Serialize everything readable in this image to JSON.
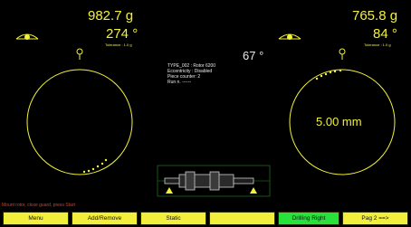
{
  "left": {
    "weight": "982.7 g",
    "angle": "274 °",
    "tolerance": "Tolerance : 1.0 g"
  },
  "right": {
    "weight": "765.8 g",
    "angle": "84 °",
    "tolerance": "Tolerance : 1.0 g",
    "distance": "5.00 mm"
  },
  "center": {
    "angle": "67 °",
    "info": [
      "TYPE_002 : Rotor 6200",
      "Eccentricity : Disabled",
      "Piece counter: 2",
      "Run n. ------"
    ]
  },
  "status_message": "Mount rotor, close guard, press Start",
  "buttons": [
    {
      "label": "Menu"
    },
    {
      "label": "Add/Remove"
    },
    {
      "label": "Static"
    },
    {
      "label": ""
    },
    {
      "label": "Drilling Right",
      "active": true
    },
    {
      "label": "Pag 2 ==>"
    }
  ],
  "colors": {
    "accent": "#f2f23a",
    "active": "#27e23b",
    "background": "#000000"
  },
  "icons": [
    "eye-icon",
    "probe-icon",
    "rotor-diagram"
  ]
}
